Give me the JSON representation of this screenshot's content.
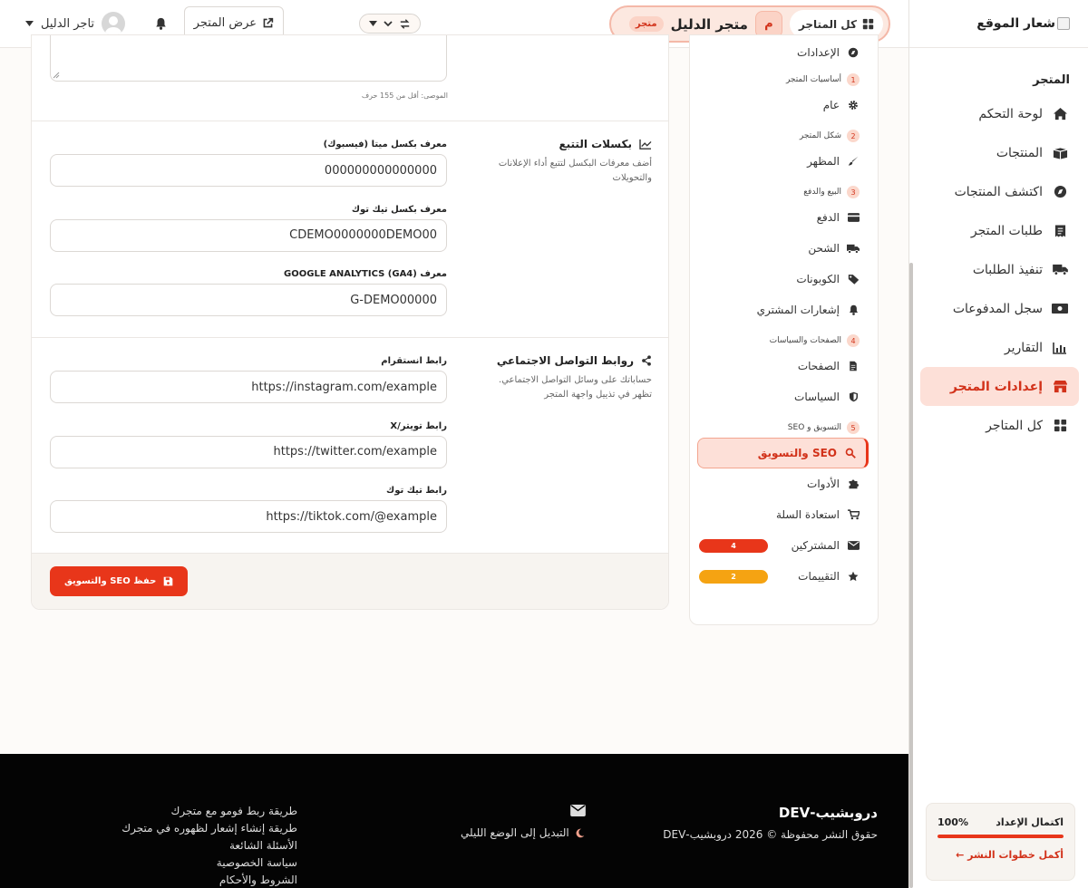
{
  "sidebar": {
    "logo_text": "شعار الموقع",
    "section_label": "المتجر",
    "items": [
      {
        "label": "لوحة التحكم",
        "icon": "home-icon"
      },
      {
        "label": "المنتجات",
        "icon": "box-icon"
      },
      {
        "label": "اكتشف المنتجات",
        "icon": "compass-icon"
      },
      {
        "label": "طلبات المتجر",
        "icon": "receipt-icon"
      },
      {
        "label": "تنفيذ الطلبات",
        "icon": "truck-icon"
      },
      {
        "label": "سجل المدفوعات",
        "icon": "money-icon"
      },
      {
        "label": "التقارير",
        "icon": "chart-icon"
      },
      {
        "label": "إعدادات المتجر",
        "icon": "store-icon",
        "active": true
      },
      {
        "label": "كل المتاجر",
        "icon": "grid-icon"
      }
    ],
    "setup": {
      "title": "اكتمال الإعداد",
      "percent": "100%",
      "progress": 1.0,
      "link": "أكمل خطوات النشر ←"
    }
  },
  "header": {
    "all_stores": "كل المتاجر",
    "store_initial": "م",
    "store_name": "متجر الدليل",
    "store_badge": "متجر",
    "view_store": "عرض المتجر",
    "user_name": "تاجر الدليل"
  },
  "submenu": {
    "top_item": "الإعدادات",
    "groups": [
      {
        "num": "1",
        "title": "أساسيات المتجر",
        "items": [
          {
            "label": "عام",
            "icon": "gear-icon"
          }
        ]
      },
      {
        "num": "2",
        "title": "شكل المتجر",
        "items": [
          {
            "label": "المظهر",
            "icon": "brush-icon"
          }
        ]
      },
      {
        "num": "3",
        "title": "البيع والدفع",
        "items": [
          {
            "label": "الدفع",
            "icon": "card-icon"
          },
          {
            "label": "الشحن",
            "icon": "truck-icon"
          },
          {
            "label": "الكوبونات",
            "icon": "tags-icon"
          },
          {
            "label": "إشعارات المشتري",
            "icon": "bell-icon"
          }
        ]
      },
      {
        "num": "4",
        "title": "الصفحات والسياسات",
        "items": [
          {
            "label": "الصفحات",
            "icon": "file-icon"
          },
          {
            "label": "السياسات",
            "icon": "shield-icon"
          }
        ]
      },
      {
        "num": "5",
        "title": "التسويق و SEO",
        "items": [
          {
            "label": "SEO والتسويق",
            "icon": "search-icon",
            "active": true
          },
          {
            "label": "الأدوات",
            "icon": "puzzle-icon"
          },
          {
            "label": "استعادة السلة",
            "icon": "cart-icon"
          },
          {
            "label": "المشتركين",
            "icon": "envelope-icon",
            "badge": "4",
            "badge_color": "#e8361a"
          },
          {
            "label": "التقييمات",
            "icon": "star-icon",
            "badge": "2",
            "badge_color": "#f5a312"
          }
        ]
      }
    ]
  },
  "form": {
    "description_hint": "الموصى: أقل من 155 حرف",
    "tracking": {
      "title": "بكسلات التتبع",
      "desc": "أضف معرفات البكسل لتتبع أداء الإعلانات والتحويلات",
      "fields": [
        {
          "label": "معرف بكسل ميتا (فيسبوك)",
          "value": "000000000000000"
        },
        {
          "label": "معرف بكسل تيك توك",
          "value": "CDEMO0000000DEMO00"
        },
        {
          "label": "معرف (GOOGLE ANALYTICS (GA4",
          "value": "G-DEMO00000"
        }
      ]
    },
    "social": {
      "title": "روابط التواصل الاجتماعي",
      "desc": "حساباتك على وسائل التواصل الاجتماعي. تظهر في تذييل واجهة المتجر",
      "fields": [
        {
          "label": "رابط انستقرام",
          "value": "https://instagram.com/example"
        },
        {
          "label": "رابط تويتر/X",
          "value": "https://twitter.com/example"
        },
        {
          "label": "رابط تيك توك",
          "value": "https://tiktok.com/@example"
        }
      ]
    },
    "save_label": "حفظ SEO والتسويق"
  },
  "footer": {
    "brand": "دروبشيب-DEV",
    "copyright": "حقوق النشر محفوظة © 2026 دروبشيب-DEV",
    "dark_mode": "التبديل إلى الوضع الليلي",
    "links": [
      "طريقة ربط فومو مع متجرك",
      "طريقة إنشاء إشعار لظهوره في متجرك",
      "الأسئلة الشائعة",
      "سياسة الخصوصية",
      "الشروط والأحكام"
    ]
  },
  "colors": {
    "accent": "#e8361a",
    "accent_soft": "#fde0d8",
    "warning": "#f5a312",
    "footer_bg": "#040404"
  }
}
